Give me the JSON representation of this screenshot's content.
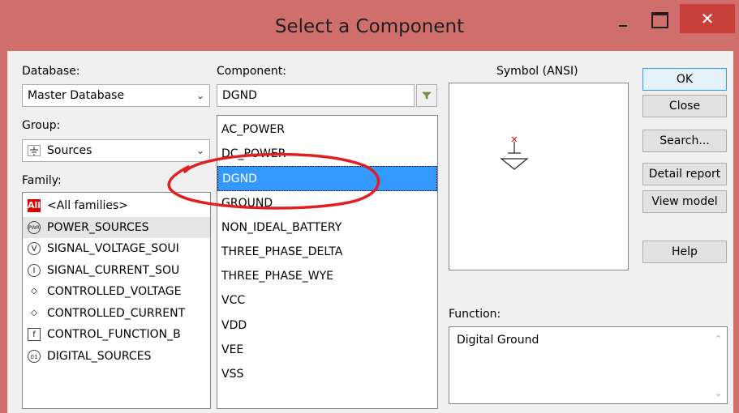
{
  "window": {
    "title": "Select a Component",
    "close_glyph": "✕"
  },
  "database": {
    "label": "Database:",
    "value": "Master Database"
  },
  "group": {
    "label": "Group:",
    "value": "Sources",
    "icon": "ground-symbol-icon"
  },
  "family": {
    "label": "Family:",
    "items": [
      {
        "label": "<All families>",
        "icon": "all-icon",
        "badge": "All"
      },
      {
        "label": "POWER_SOURCES",
        "icon": "power-source-icon",
        "glyph": "PWR"
      },
      {
        "label": "SIGNAL_VOLTAGE_SOUI",
        "icon": "signal-voltage-icon",
        "glyph": "V"
      },
      {
        "label": "SIGNAL_CURRENT_SOU",
        "icon": "signal-current-icon",
        "glyph": "I"
      },
      {
        "label": "CONTROLLED_VOLTAGE",
        "icon": "controlled-voltage-icon",
        "glyph": "◇"
      },
      {
        "label": "CONTROLLED_CURRENT",
        "icon": "controlled-current-icon",
        "glyph": "◇"
      },
      {
        "label": "CONTROL_FUNCTION_B",
        "icon": "control-function-icon",
        "glyph": "f"
      },
      {
        "label": "DIGITAL_SOURCES",
        "icon": "digital-source-icon",
        "glyph": "01"
      }
    ],
    "selected_index": 1
  },
  "component": {
    "label": "Component:",
    "value": "DGND",
    "items": [
      "AC_POWER",
      "DC_POWER",
      "DGND",
      "GROUND",
      "NON_IDEAL_BATTERY",
      "THREE_PHASE_DELTA",
      "THREE_PHASE_WYE",
      "VCC",
      "VDD",
      "VEE",
      "VSS"
    ],
    "selected_index": 2
  },
  "symbol": {
    "label": "Symbol (ANSI)"
  },
  "function": {
    "label": "Function:",
    "value": "Digital Ground"
  },
  "buttons": {
    "ok": "OK",
    "close": "Close",
    "search": "Search...",
    "detail": "Detail report",
    "view_model": "View model",
    "help": "Help"
  },
  "colors": {
    "titlebar": "#cf6e6b",
    "close": "#c9403a",
    "selection": "#3399ff",
    "annotation": "#e02020"
  }
}
